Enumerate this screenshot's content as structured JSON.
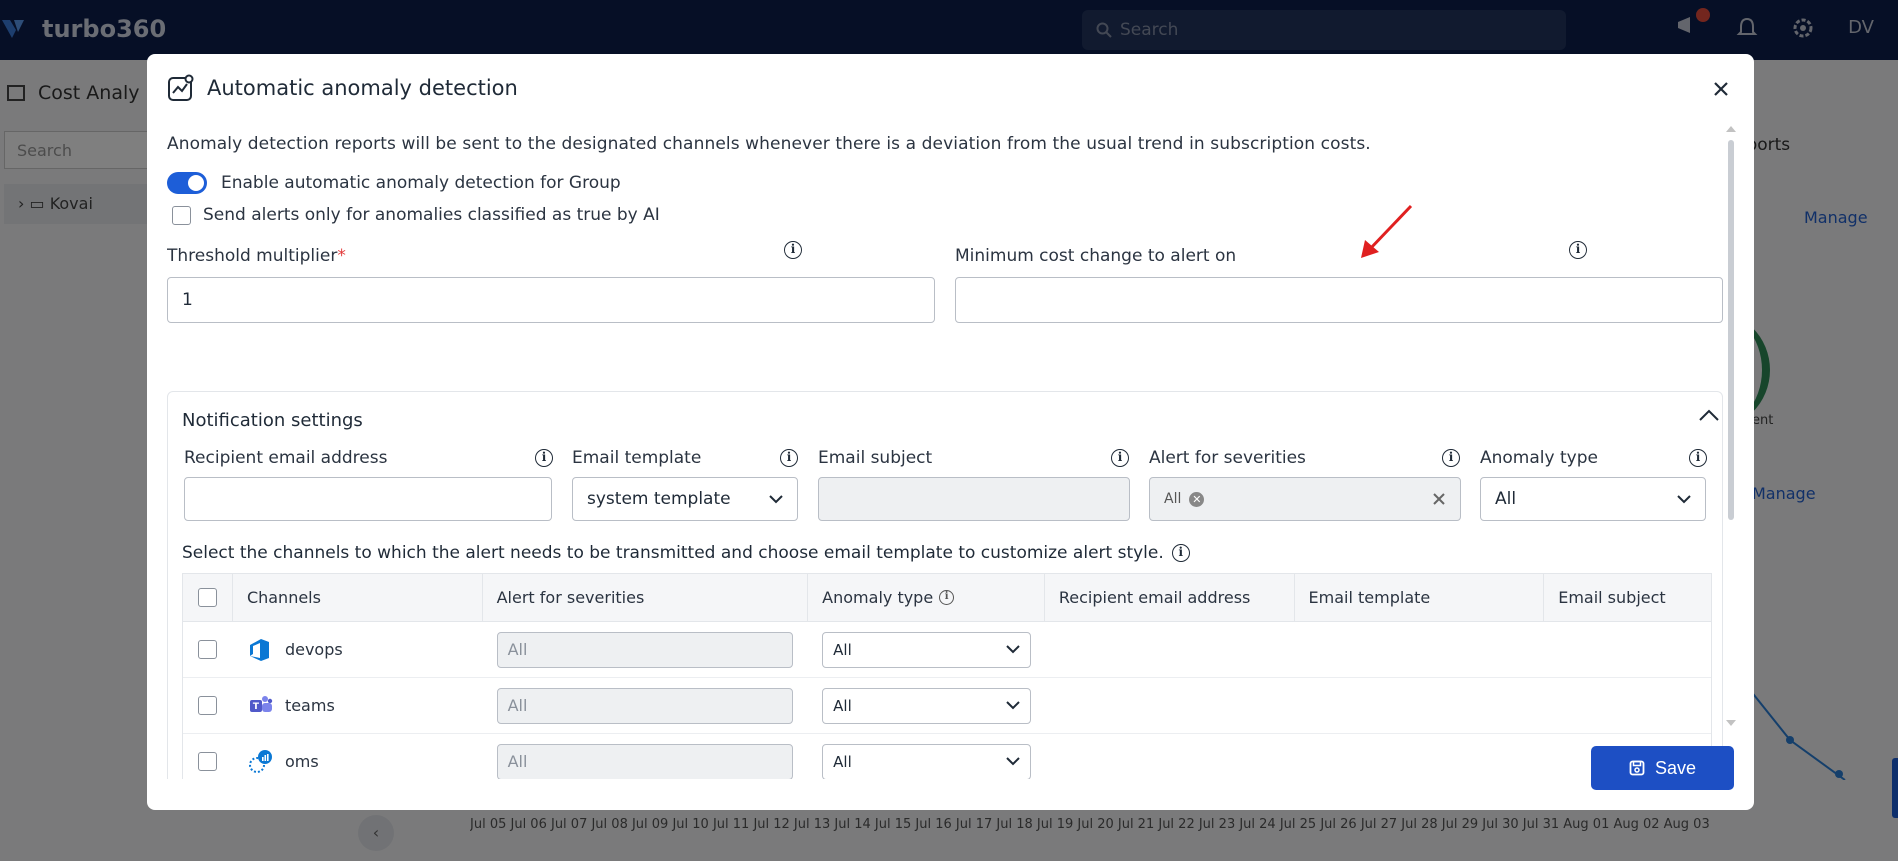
{
  "app": {
    "logo_text": "turbo360",
    "search_placeholder": "Search",
    "user_initials": "DV",
    "bg_title": "Cost Analy",
    "bg_search_placeholder": "Search",
    "bg_tree_item": "Kovai",
    "bg_tab": "eports",
    "bg_manage": "Manage",
    "bg_ring_label": "ent",
    "bg_dates": "Jul 05  Jul 06  Jul 07  Jul 08  Jul 09  Jul 10  Jul 11  Jul 12  Jul 13  Jul 14  Jul 15  Jul 16  Jul 17  Jul 18  Jul 19  Jul 20  Jul 21  Jul 22  Jul 23  Jul 24  Jul 25  Jul 26  Jul 27  Jul 28  Jul 29  Jul 30  Jul 31  Aug 01  Aug 02  Aug 03"
  },
  "modal": {
    "title": "Automatic anomaly detection",
    "description": "Anomaly detection reports will be sent to the designated channels whenever there is a deviation from the usual trend in subscription costs.",
    "enable_toggle_label": "Enable automatic anomaly detection for Group",
    "enable_toggle_on": true,
    "ai_checkbox_label": "Send alerts only for anomalies classified as true by AI",
    "threshold": {
      "label": "Threshold multiplier",
      "required_mark": "*",
      "value": "1"
    },
    "min_cost": {
      "label": "Minimum cost change to alert on",
      "value": ""
    },
    "notification": {
      "title": "Notification settings",
      "recipient_label": "Recipient email address",
      "recipient_value": "",
      "template_label": "Email template",
      "template_value": "system template",
      "subject_label": "Email subject",
      "subject_value": "",
      "severities_label": "Alert for severities",
      "severities_chip": "All",
      "anomaly_label": "Anomaly type",
      "anomaly_value": "All",
      "channels_caption": "Select the channels to which the alert needs to be transmitted and choose email template to customize alert style.",
      "table": {
        "headers": {
          "channels": "Channels",
          "severities": "Alert for severities",
          "anomaly": "Anomaly type",
          "recipient": "Recipient email address",
          "template": "Email template",
          "subject": "Email subject"
        },
        "rows": [
          {
            "name": "devops",
            "icon": "azure-devops-icon",
            "severities_placeholder": "All",
            "anomaly": "All"
          },
          {
            "name": "teams",
            "icon": "ms-teams-icon",
            "severities_placeholder": "All",
            "anomaly": "All"
          },
          {
            "name": "oms",
            "icon": "oms-icon",
            "severities_placeholder": "All",
            "anomaly": "All"
          }
        ]
      }
    },
    "save_label": "Save"
  },
  "colors": {
    "primary": "#1d5ed8",
    "save_button": "#1d4fc4",
    "annotation_arrow": "#e02020",
    "topbar": "#0d1f4d"
  }
}
